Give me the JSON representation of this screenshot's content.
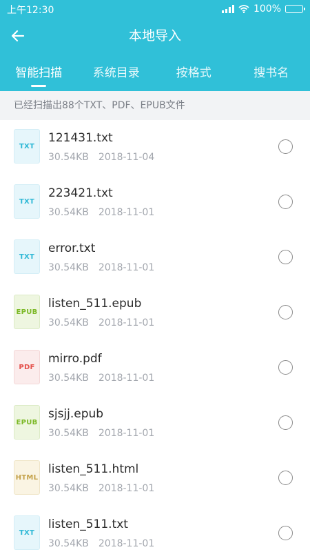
{
  "status_bar": {
    "time": "上午12:30",
    "battery": "100%",
    "battery_level": 1.0
  },
  "header": {
    "title": "本地导入",
    "back_icon": "arrow-left-icon",
    "bg_color": "#30c0d8"
  },
  "tabs": [
    {
      "label": "智能扫描",
      "active": true
    },
    {
      "label": "系统目录",
      "active": false
    },
    {
      "label": "按格式",
      "active": false
    },
    {
      "label": "搜书名",
      "active": false
    }
  ],
  "summary": "已经扫描出88个TXT、PDF、EPUB文件",
  "files": [
    {
      "name": "121431.txt",
      "size": "30.54KB",
      "date": "2018-11-04",
      "type": "TXT"
    },
    {
      "name": "223421.txt",
      "size": "30.54KB",
      "date": "2018-11-01",
      "type": "TXT"
    },
    {
      "name": "error.txt",
      "size": "30.54KB",
      "date": "2018-11-01",
      "type": "TXT"
    },
    {
      "name": "listen_511.epub",
      "size": "30.54KB",
      "date": "2018-11-01",
      "type": "EPUB"
    },
    {
      "name": "mirro.pdf",
      "size": "30.54KB",
      "date": "2018-11-01",
      "type": "PDF"
    },
    {
      "name": "sjsjj.epub",
      "size": "30.54KB",
      "date": "2018-11-01",
      "type": "EPUB"
    },
    {
      "name": "listen_511.html",
      "size": "30.54KB",
      "date": "2018-11-01",
      "type": "HTML"
    },
    {
      "name": "listen_511.txt",
      "size": "30.54KB",
      "date": "2018-11-01",
      "type": "TXT"
    }
  ]
}
